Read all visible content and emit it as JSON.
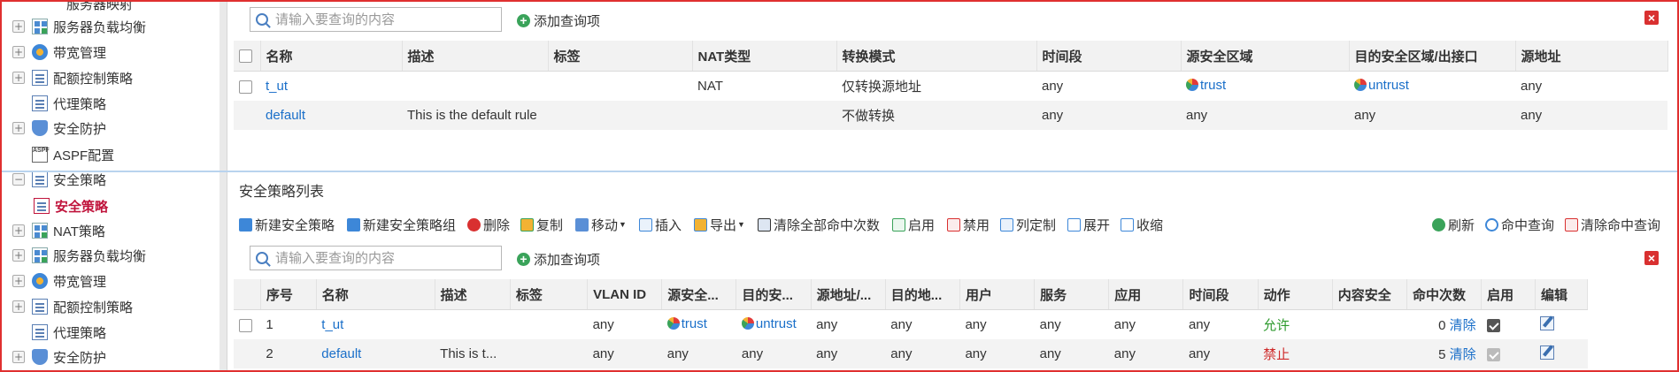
{
  "nav": {
    "top_partial": "服务器映射",
    "upper_items": [
      {
        "label": "服务器负载均衡",
        "icon": "server-balance-icon"
      },
      {
        "label": "带宽管理",
        "icon": "bandwidth-icon"
      },
      {
        "label": "配额控制策略",
        "icon": "quota-icon"
      },
      {
        "label": "代理策略",
        "icon": "proxy-icon"
      },
      {
        "label": "安全防护",
        "icon": "shield-icon"
      },
      {
        "label": "ASPF配置",
        "icon": "aspf-icon"
      }
    ],
    "group_label": "安全策略",
    "active_item": "安全策略",
    "lower_items": [
      {
        "label": "NAT策略",
        "icon": "nat-icon"
      },
      {
        "label": "服务器负载均衡",
        "icon": "server-balance-icon"
      },
      {
        "label": "带宽管理",
        "icon": "bandwidth-icon"
      },
      {
        "label": "配额控制策略",
        "icon": "quota-icon"
      },
      {
        "label": "代理策略",
        "icon": "proxy-icon"
      },
      {
        "label": "安全防护",
        "icon": "shield-icon"
      }
    ],
    "aspf_badge": "ASPF"
  },
  "nat_panel": {
    "search_placeholder": "请输入要查询的内容",
    "add_query_label": "添加查询项",
    "columns": [
      "名称",
      "描述",
      "标签",
      "NAT类型",
      "转换模式",
      "时间段",
      "源安全区域",
      "目的安全区域/出接口",
      "源地址"
    ],
    "rows": [
      {
        "name": "t_ut",
        "desc": "",
        "tag": "",
        "nat_type": "NAT",
        "mode": "仅转换源地址",
        "time": "any",
        "src_zone": "trust",
        "dst_zone": "untrust",
        "src_addr": "any"
      },
      {
        "name": "default",
        "desc": "This is the default rule",
        "tag": "",
        "nat_type": "",
        "mode": "不做转换",
        "time": "any",
        "src_zone": "any",
        "dst_zone": "any",
        "src_addr": "any"
      }
    ]
  },
  "sec_panel": {
    "title": "安全策略列表",
    "toolbar": {
      "new_policy": "新建安全策略",
      "new_group": "新建安全策略组",
      "delete": "删除",
      "copy": "复制",
      "move": "移动",
      "insert": "插入",
      "export": "导出",
      "clear_all_hits": "清除全部命中次数",
      "enable": "启用",
      "disable": "禁用",
      "customize_columns": "列定制",
      "expand": "展开",
      "collapse": "收缩",
      "refresh": "刷新",
      "hit_query": "命中查询",
      "clear_hit_query": "清除命中查询"
    },
    "search_placeholder": "请输入要查询的内容",
    "add_query_label": "添加查询项",
    "columns": [
      "序号",
      "名称",
      "描述",
      "标签",
      "VLAN ID",
      "源安全...",
      "目的安...",
      "源地址/...",
      "目的地...",
      "用户",
      "服务",
      "应用",
      "时间段",
      "动作",
      "内容安全",
      "命中次数",
      "启用",
      "编辑"
    ],
    "rows": [
      {
        "seq": "1",
        "name": "t_ut",
        "desc": "",
        "tag": "",
        "vlan": "any",
        "src_zone": "trust",
        "dst_zone": "untrust",
        "src_addr": "any",
        "dst_addr": "any",
        "user": "any",
        "service": "any",
        "app": "any",
        "time": "any",
        "action": "允许",
        "content": "",
        "hits": "0",
        "clear": "清除",
        "enabled": true
      },
      {
        "seq": "2",
        "name": "default",
        "desc": "This is t...",
        "tag": "",
        "vlan": "any",
        "src_zone": "any",
        "dst_zone": "any",
        "src_addr": "any",
        "dst_addr": "any",
        "user": "any",
        "service": "any",
        "app": "any",
        "time": "any",
        "action": "禁止",
        "content": "",
        "hits": "5",
        "clear": "清除",
        "enabled": true
      }
    ]
  },
  "colors": {
    "accent_red": "#d93030",
    "link": "#1a6fc9",
    "allow": "#2d9a2d",
    "deny": "#cf2b2b"
  }
}
